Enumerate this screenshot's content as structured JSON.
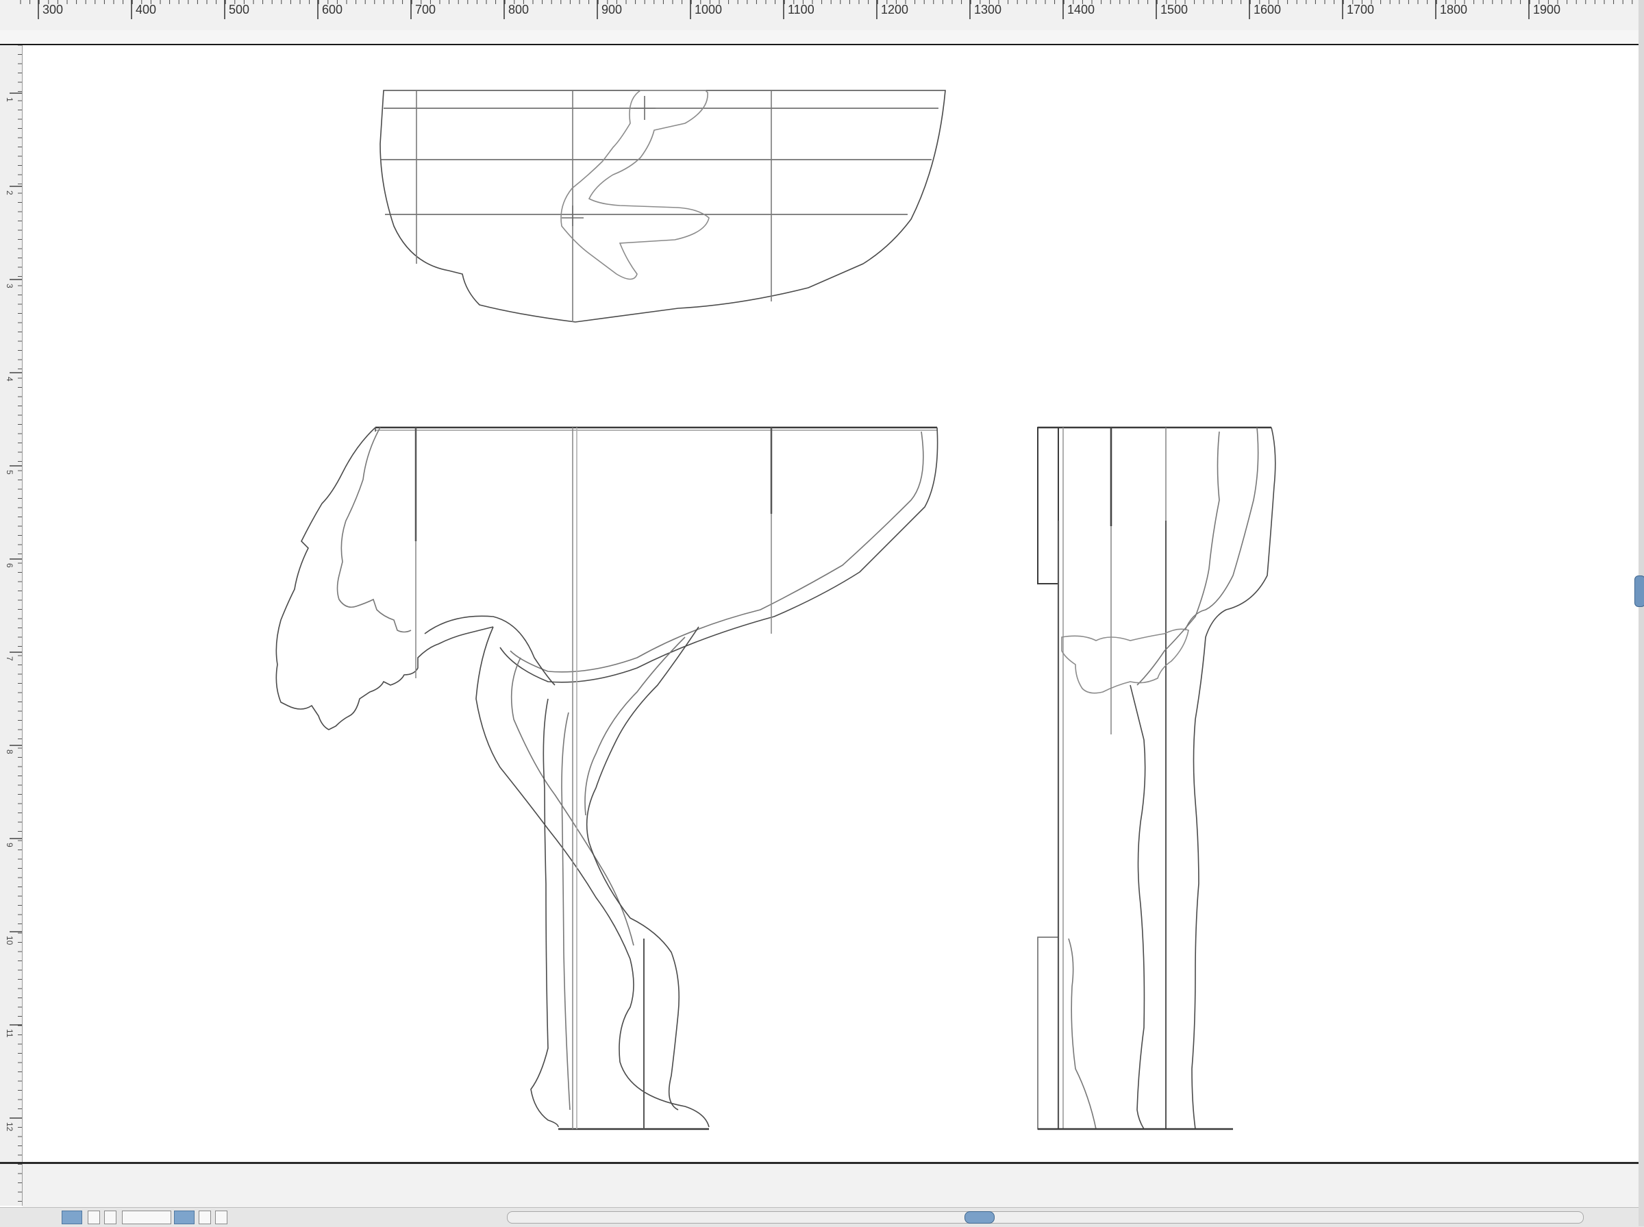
{
  "ruler": {
    "labels": [
      "300",
      "400",
      "500",
      "600",
      "700",
      "800",
      "900",
      "1000",
      "1100",
      "1200",
      "1300",
      "1400",
      "1500",
      "1600",
      "1700",
      "1800",
      "1900"
    ],
    "left_labels": [
      "1",
      "2",
      "3",
      "4",
      "5",
      "6",
      "7",
      "8",
      "9",
      "10",
      "11",
      "12"
    ]
  },
  "drawing": {
    "views": [
      "top-view",
      "front-view",
      "side-view"
    ],
    "line_color": "#4a4a4a",
    "guide_color": "#9a9a9a"
  },
  "colors": {
    "accent": "#6e95bf",
    "ruler_bg": "#f1f1f1"
  }
}
